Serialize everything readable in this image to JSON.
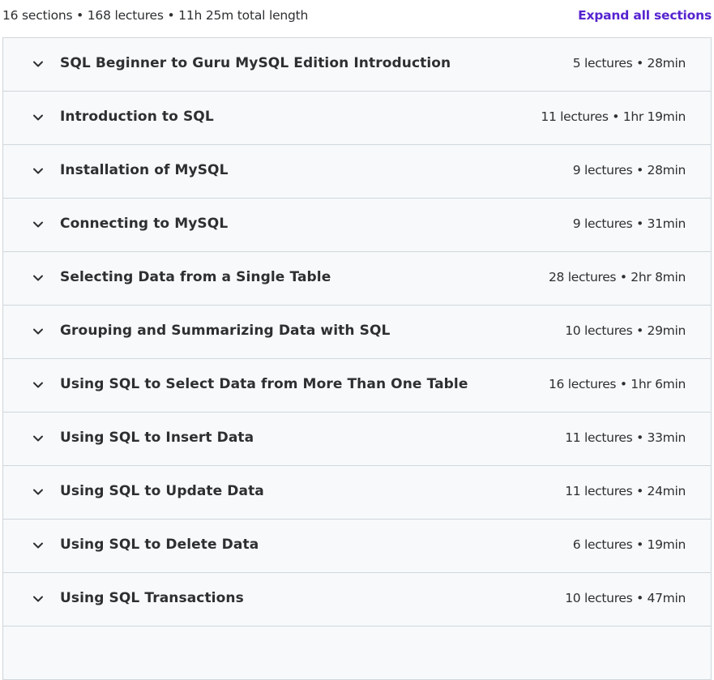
{
  "summary": {
    "text": "16 sections • 168 lectures • 11h 25m total length",
    "expand_label": "Expand all sections"
  },
  "sections": [
    {
      "title": "SQL Beginner to Guru MySQL Edition Introduction",
      "meta": "5 lectures • 28min"
    },
    {
      "title": "Introduction to SQL",
      "meta": "11 lectures • 1hr 19min"
    },
    {
      "title": "Installation of MySQL",
      "meta": "9 lectures • 28min"
    },
    {
      "title": "Connecting to MySQL",
      "meta": "9 lectures • 31min"
    },
    {
      "title": "Selecting Data from a Single Table",
      "meta": "28 lectures • 2hr 8min"
    },
    {
      "title": "Grouping and Summarizing Data with SQL",
      "meta": "10 lectures • 29min"
    },
    {
      "title": "Using SQL to Select Data from More Than One Table",
      "meta": "16 lectures • 1hr 6min"
    },
    {
      "title": "Using SQL to Insert Data",
      "meta": "11 lectures • 33min"
    },
    {
      "title": "Using SQL to Update Data",
      "meta": "11 lectures • 24min"
    },
    {
      "title": "Using SQL to Delete Data",
      "meta": "6 lectures • 19min"
    },
    {
      "title": "Using SQL Transactions",
      "meta": "10 lectures • 47min"
    },
    {
      "title": "",
      "meta": ""
    }
  ],
  "icons": {
    "section_toggle": "chevron-down-icon"
  },
  "colors": {
    "accent": "#5624d0",
    "row_background": "#f7f9fa",
    "border": "#d1d7dc",
    "text": "#2d2f31"
  }
}
